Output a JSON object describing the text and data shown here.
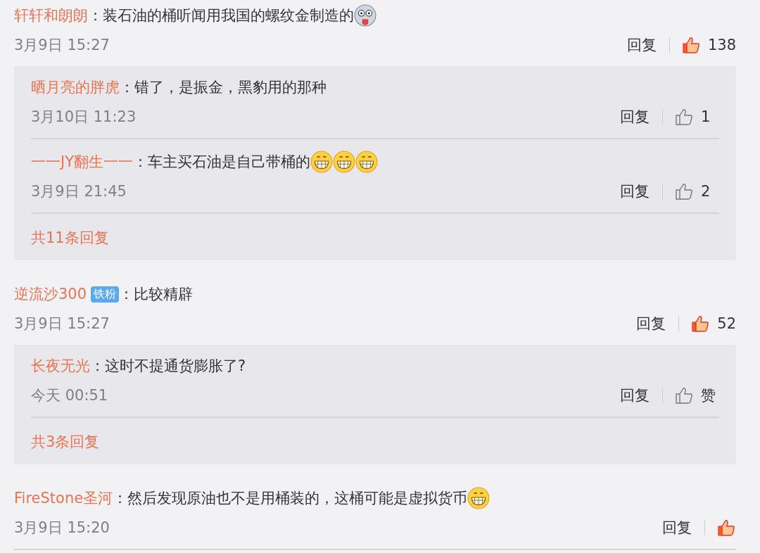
{
  "comments": [
    {
      "user": "轩轩和朗朗",
      "text": "：装石油的桶听闻用我国的螺纹金制造的",
      "emojis": [
        {
          "kind": "dizzy"
        }
      ],
      "time": "3月9日 15:27",
      "reply": "回复",
      "likes": {
        "count": "138",
        "liked": true
      },
      "replies": [
        {
          "user": "晒月亮的胖虎",
          "text": "：错了，是振金，黑豹用的那种",
          "time": "3月10日 11:23",
          "reply": "回复",
          "likes": {
            "count": "1",
            "liked": false
          }
        },
        {
          "user": "一一JY翻生一一",
          "text": "：车主买石油是自己带桶的",
          "emojis": [
            {
              "kind": "grin"
            },
            {
              "kind": "grin"
            },
            {
              "kind": "grin"
            }
          ],
          "time": "3月9日 21:45",
          "reply": "回复",
          "likes": {
            "count": "2",
            "liked": false
          }
        }
      ],
      "more": "共11条回复"
    },
    {
      "user": "逆流沙300",
      "badge": "铁粉",
      "text": "：比较精辟",
      "time": "3月9日 15:27",
      "reply": "回复",
      "likes": {
        "count": "52",
        "liked": true
      },
      "replies": [
        {
          "user": "长夜无光",
          "text": "：这时不提通货膨胀了?",
          "time": "今天 00:51",
          "reply": "回复",
          "likes": {
            "count": "赞",
            "liked": false
          }
        }
      ],
      "more": "共3条回复"
    },
    {
      "user": "FireStone圣河",
      "text": "：然后发现原油也不是用桶装的，这桶可能是虚拟货币",
      "emojis": [
        {
          "kind": "grin"
        }
      ],
      "time": "3月9日 15:20",
      "reply": "回复",
      "likes": {
        "liked": true
      }
    }
  ]
}
